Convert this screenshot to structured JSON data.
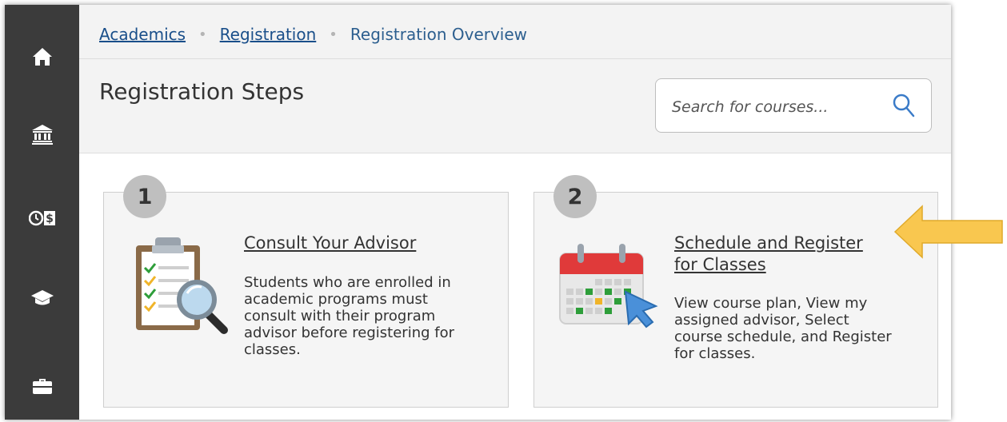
{
  "sidebar": {
    "items": [
      {
        "icon": "home-icon"
      },
      {
        "icon": "bank-icon"
      },
      {
        "icon": "finance-icon"
      },
      {
        "icon": "graduation-cap-icon"
      },
      {
        "icon": "briefcase-icon"
      }
    ],
    "background": "#3b3b3b"
  },
  "breadcrumb": {
    "items": [
      "Academics",
      "Registration",
      "Registration Overview"
    ],
    "separator": "•"
  },
  "header": {
    "title": "Registration Steps"
  },
  "search": {
    "placeholder": "Search for courses...",
    "value": "",
    "icon": "search-icon"
  },
  "steps": [
    {
      "number": "1",
      "title_lines": [
        "Consult Your Advisor"
      ],
      "description_lines": [
        "Students who are enrolled in",
        "academic programs must",
        "consult with their program",
        "advisor before registering for",
        "classes."
      ],
      "icon": "clipboard-magnifier-icon"
    },
    {
      "number": "2",
      "title_lines": [
        "Schedule and Register",
        "for Classes"
      ],
      "description_lines": [
        "View course plan, View my",
        "assigned advisor, Select",
        "course schedule, and Register",
        "for classes."
      ],
      "icon": "calendar-cursor-icon"
    }
  ],
  "annotation": {
    "icon": "arrow-pointer-icon",
    "color": "#f9c74f"
  },
  "colors": {
    "link": "#1a4f8a",
    "header_bg": "#f3f3f3",
    "card_bg": "#f5f5f5",
    "badge": "#bfbfbf"
  }
}
